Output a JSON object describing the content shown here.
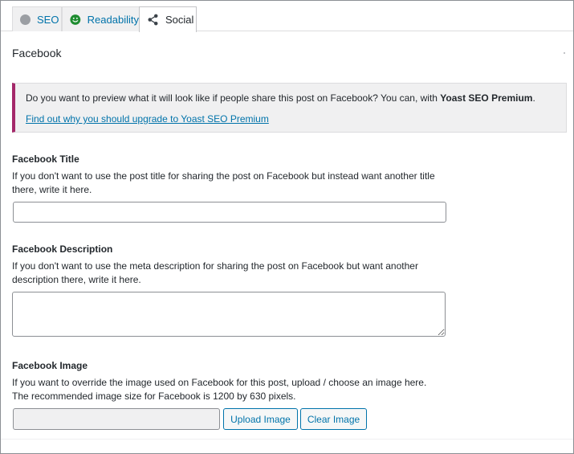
{
  "tabs": [
    {
      "label": "SEO",
      "icon": "gray-circle-icon",
      "color": "#9b9ea3"
    },
    {
      "label": "Readability",
      "icon": "smiley-icon",
      "color": "#1e8c30"
    },
    {
      "label": "Social",
      "icon": "share-icon",
      "active": true
    }
  ],
  "section": {
    "title": "Facebook"
  },
  "notice": {
    "text": "Do you want to preview what it will look like if people share this post on Facebook? You can, with ",
    "brand": "Yoast SEO Premium",
    "text_end": ".",
    "link": "Find out why you should upgrade to Yoast SEO Premium",
    "accent_color": "#a4286a"
  },
  "fields": {
    "title": {
      "label": "Facebook Title",
      "help": "If you don't want to use the post title for sharing the post on Facebook but instead want another title there, write it here.",
      "value": ""
    },
    "description": {
      "label": "Facebook Description",
      "help": "If you don't want to use the meta description for sharing the post on Facebook but want another description there, write it here.",
      "value": ""
    },
    "image": {
      "label": "Facebook Image",
      "help": "If you want to override the image used on Facebook for this post, upload / choose an image here. The recommended image size for Facebook is 1200 by 630 pixels.",
      "value": "",
      "upload_label": "Upload Image",
      "clear_label": "Clear Image"
    }
  }
}
